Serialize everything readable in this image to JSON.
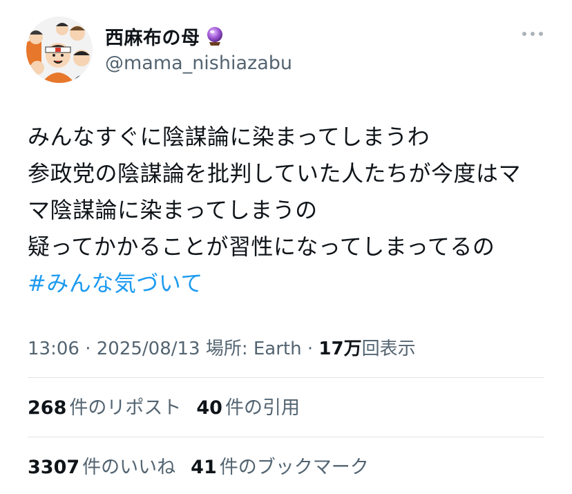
{
  "user": {
    "display_name": "西麻布の母",
    "handle": "@mama_nishiazabu",
    "emoji_icon": "crystal-ball-icon"
  },
  "tweet": {
    "lines": [
      "みんなすぐに陰謀論に染まってしまうわ",
      "参政党の陰謀論を批判していた人たちが今度はマ",
      "マ陰謀論に染まってしまうの",
      "疑ってかかることが習性になってしまってるの"
    ],
    "hashtag": "#みんな気づいて"
  },
  "meta": {
    "time": "13:06",
    "sep1": " · ",
    "date": "2025/08/13",
    "location": " 場所: Earth",
    "sep2": " · ",
    "views_num": "17万",
    "views_label": "回表示"
  },
  "stats": {
    "reposts_num": "268",
    "reposts_label": "件のリポスト",
    "quotes_num": "40",
    "quotes_label": "件の引用",
    "likes_num": "3307",
    "likes_label": "件のいいね",
    "bookmarks_num": "41",
    "bookmarks_label": "件のブックマーク"
  },
  "colors": {
    "accent": "#1d9bf0",
    "secondary_text": "#536471",
    "primary_text": "#0f1419",
    "divider": "#dfe3e6"
  }
}
